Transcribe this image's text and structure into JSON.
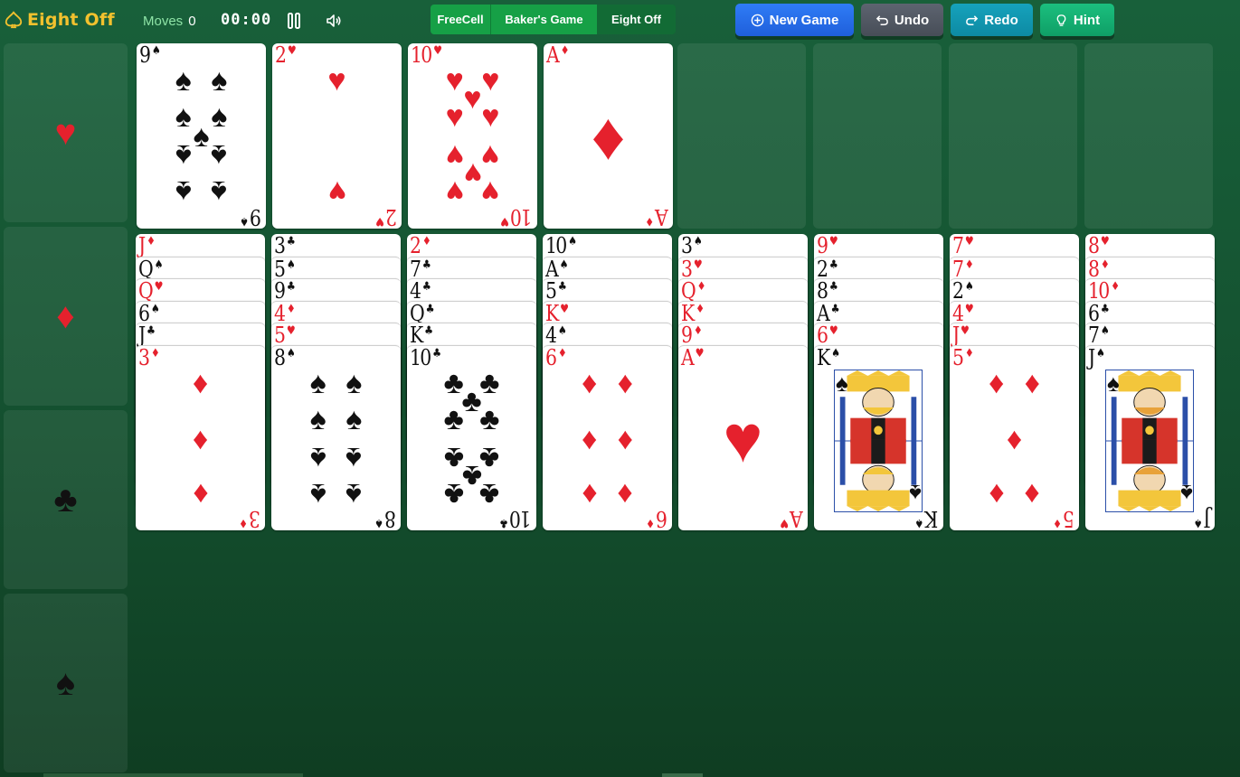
{
  "header": {
    "logo_text": "Eight Off",
    "moves_label": "Moves",
    "moves_count": "0",
    "timer": "00:00"
  },
  "modes": [
    {
      "label": "FreeCell"
    },
    {
      "label": "Baker's Game"
    },
    {
      "label": "Eight Off"
    }
  ],
  "buttons": {
    "new_game": "New Game",
    "undo": "Undo",
    "redo": "Redo",
    "hint": "Hint"
  },
  "colors": {
    "accent_logo": "#f2c12e",
    "card_red": "#e5212d",
    "card_black": "#111111"
  },
  "foundations": [
    {
      "suit": "♥",
      "color": "red"
    },
    {
      "suit": "♦",
      "color": "red"
    },
    {
      "suit": "♣",
      "color": "black"
    },
    {
      "suit": "♠",
      "color": "black"
    }
  ],
  "reserve": [
    {
      "rank": "9",
      "suit": "♠"
    },
    {
      "rank": "2",
      "suit": "♥"
    },
    {
      "rank": "10",
      "suit": "♥"
    },
    {
      "rank": "A",
      "suit": "♦"
    },
    null,
    null,
    null,
    null
  ],
  "tableau": [
    [
      {
        "rank": "J",
        "suit": "♦"
      },
      {
        "rank": "Q",
        "suit": "♠"
      },
      {
        "rank": "Q",
        "suit": "♥"
      },
      {
        "rank": "6",
        "suit": "♠"
      },
      {
        "rank": "J",
        "suit": "♣"
      },
      {
        "rank": "3",
        "suit": "♦"
      }
    ],
    [
      {
        "rank": "3",
        "suit": "♣"
      },
      {
        "rank": "5",
        "suit": "♠"
      },
      {
        "rank": "9",
        "suit": "♣"
      },
      {
        "rank": "4",
        "suit": "♦"
      },
      {
        "rank": "5",
        "suit": "♥"
      },
      {
        "rank": "8",
        "suit": "♠"
      }
    ],
    [
      {
        "rank": "2",
        "suit": "♦"
      },
      {
        "rank": "7",
        "suit": "♣"
      },
      {
        "rank": "4",
        "suit": "♣"
      },
      {
        "rank": "Q",
        "suit": "♣"
      },
      {
        "rank": "K",
        "suit": "♣"
      },
      {
        "rank": "10",
        "suit": "♣"
      }
    ],
    [
      {
        "rank": "10",
        "suit": "♠"
      },
      {
        "rank": "A",
        "suit": "♠"
      },
      {
        "rank": "5",
        "suit": "♣"
      },
      {
        "rank": "K",
        "suit": "♥"
      },
      {
        "rank": "4",
        "suit": "♠"
      },
      {
        "rank": "6",
        "suit": "♦"
      }
    ],
    [
      {
        "rank": "3",
        "suit": "♠"
      },
      {
        "rank": "3",
        "suit": "♥"
      },
      {
        "rank": "Q",
        "suit": "♦"
      },
      {
        "rank": "K",
        "suit": "♦"
      },
      {
        "rank": "9",
        "suit": "♦"
      },
      {
        "rank": "A",
        "suit": "♥"
      }
    ],
    [
      {
        "rank": "9",
        "suit": "♥"
      },
      {
        "rank": "2",
        "suit": "♣"
      },
      {
        "rank": "8",
        "suit": "♣"
      },
      {
        "rank": "A",
        "suit": "♣"
      },
      {
        "rank": "6",
        "suit": "♥"
      },
      {
        "rank": "K",
        "suit": "♠"
      }
    ],
    [
      {
        "rank": "7",
        "suit": "♥"
      },
      {
        "rank": "7",
        "suit": "♦"
      },
      {
        "rank": "2",
        "suit": "♠"
      },
      {
        "rank": "4",
        "suit": "♥"
      },
      {
        "rank": "J",
        "suit": "♥"
      },
      {
        "rank": "5",
        "suit": "♦"
      }
    ],
    [
      {
        "rank": "8",
        "suit": "♥"
      },
      {
        "rank": "8",
        "suit": "♦"
      },
      {
        "rank": "10",
        "suit": "♦"
      },
      {
        "rank": "6",
        "suit": "♣"
      },
      {
        "rank": "7",
        "suit": "♠"
      },
      {
        "rank": "J",
        "suit": "♠"
      }
    ]
  ]
}
